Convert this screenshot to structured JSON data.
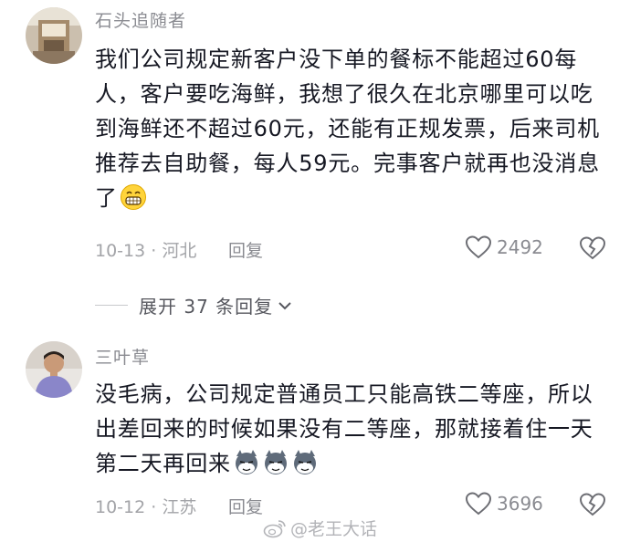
{
  "comments": [
    {
      "username": "石头追随者",
      "content": "我们公司规定新客户没下单的餐标不能超过60每人，客户要吃海鲜，我想了很久在北京哪里可以吃到海鲜还不超过60元，还能有正规发票，后来司机推荐去自助餐，每人59元。完事客户就再也没消息了",
      "emoji": "grinning-face",
      "date_location": "10-13 · 河北",
      "reply_label": "回复",
      "likes": "2492"
    },
    {
      "username": "三叶草",
      "content": "没毛病，公司规定普通员工只能高铁二等座，所以出差回来的时候如果没有二等座，那就接着住一天第二天再回来",
      "emoji": "smirking-dog-x3",
      "date_location": "10-12 · 江苏",
      "reply_label": "回复",
      "likes": "3696"
    }
  ],
  "expand_replies": "展开 37 条回复",
  "watermark": "@老王大话"
}
